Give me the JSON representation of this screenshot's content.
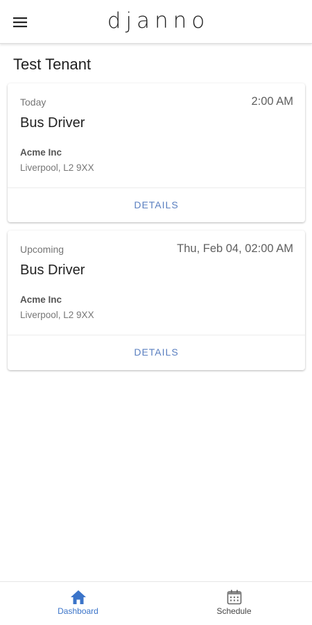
{
  "header": {
    "brand": "djanno",
    "menu_icon": "hamburger-menu-icon"
  },
  "tenant_name": "Test Tenant",
  "shifts": [
    {
      "status": "Today",
      "time": "2:00 AM",
      "title": "Bus Driver",
      "company": "Acme Inc",
      "address": "Liverpool, L2 9XX",
      "action_label": "DETAILS"
    },
    {
      "status": "Upcoming",
      "time": "Thu, Feb 04, 02:00 AM",
      "title": "Bus Driver",
      "company": "Acme Inc",
      "address": "Liverpool, L2 9XX",
      "action_label": "DETAILS"
    }
  ],
  "bottom_nav": {
    "items": [
      {
        "label": "Dashboard",
        "icon": "home-icon",
        "active": true
      },
      {
        "label": "Schedule",
        "icon": "calendar-icon",
        "active": false
      }
    ]
  },
  "colors": {
    "accent": "#3b74c9",
    "link": "#5a7fc0",
    "active_nav": "#3b74c9"
  }
}
